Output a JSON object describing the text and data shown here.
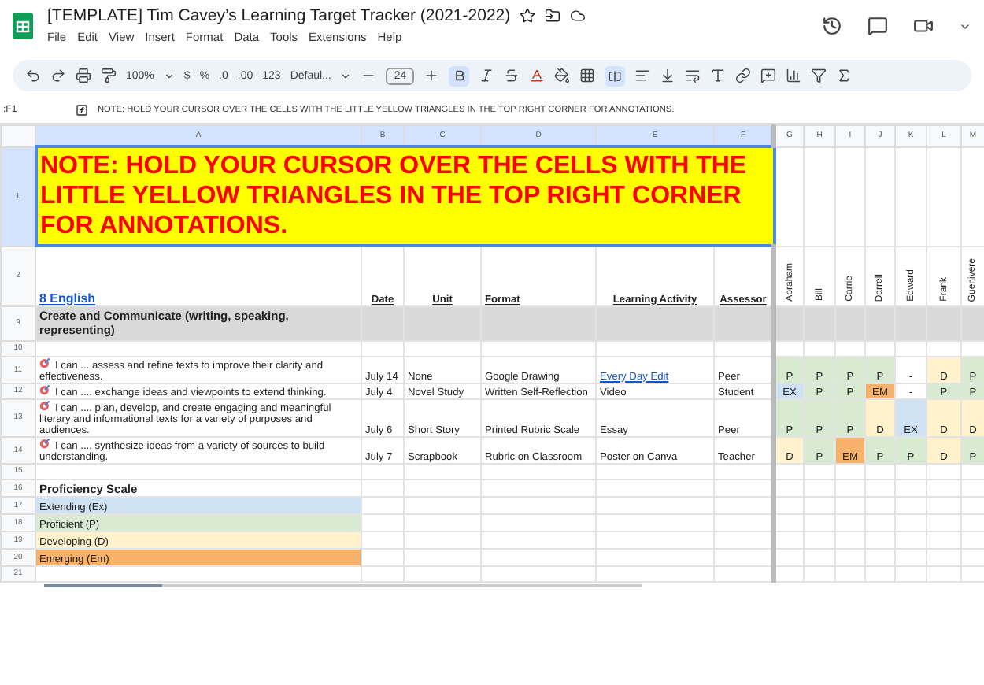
{
  "document": {
    "title": "[TEMPLATE] Tim Cavey’s Learning Target Tracker (2021-2022)"
  },
  "menu": [
    "File",
    "Edit",
    "View",
    "Insert",
    "Format",
    "Data",
    "Tools",
    "Extensions",
    "Help"
  ],
  "toolbar": {
    "zoom": "100%",
    "currency": "$",
    "percent": "%",
    "decrease_decimals": ".0",
    "increase_decimals": ".00",
    "number_format": "123",
    "font": "Defaul...",
    "font_size": "24",
    "bold_on": true,
    "merge_on": true
  },
  "formula_bar": {
    "cell_ref": ":F1",
    "formula": "NOTE: HOLD YOUR CURSOR OVER THE CELLS WITH THE LITTLE YELLOW TRIANGLES IN THE TOP RIGHT CORNER FOR ANNOTATIONS."
  },
  "columns": [
    {
      "label": "A",
      "selected": true
    },
    {
      "label": "B",
      "selected": true
    },
    {
      "label": "C",
      "selected": true
    },
    {
      "label": "D",
      "selected": true
    },
    {
      "label": "E",
      "selected": true
    },
    {
      "label": "F",
      "selected": true
    },
    {
      "label": "G",
      "selected": false
    },
    {
      "label": "H",
      "selected": false
    },
    {
      "label": "I",
      "selected": false
    },
    {
      "label": "J",
      "selected": false
    },
    {
      "label": "K",
      "selected": false
    },
    {
      "label": "L",
      "selected": false
    },
    {
      "label": "M",
      "selected": false
    }
  ],
  "rows": [
    {
      "kind": "note",
      "number": "1",
      "selected": true,
      "text": "NOTE: HOLD YOUR CURSOR OVER THE CELLS WITH THE LITTLE YELLOW TRIANGLES IN THE TOP RIGHT CORNER FOR ANNOTATIONS."
    },
    {
      "kind": "header",
      "number": "2",
      "selected": false,
      "title": "8 English",
      "headings": [
        "Date",
        "Unit",
        "Format",
        "Learning Activity",
        "Assessor"
      ],
      "students": [
        "Abraham",
        "Bill",
        "Carrie",
        "Darrell",
        "Edward",
        "Frank",
        "Guenivere"
      ]
    },
    {
      "kind": "section",
      "number": "9",
      "selected": false,
      "text": "Create and Communicate (writing, speaking, representing)"
    },
    {
      "kind": "blank",
      "number": "10",
      "selected": false
    },
    {
      "kind": "target",
      "number": "11",
      "selected": false,
      "text": "I can ... assess and refine texts to improve their clarity and effectiveness.",
      "date": "July 14",
      "unit": "None",
      "format": "Google Drawing",
      "activity": {
        "text": "Every Day Edit",
        "link": true
      },
      "assessor": "Peer",
      "grades": [
        {
          "grade": "P",
          "color": "#d9ead3"
        },
        {
          "grade": "P",
          "color": "#d9ead3"
        },
        {
          "grade": "P",
          "color": "#d9ead3"
        },
        {
          "grade": "P",
          "color": "#d9ead3"
        },
        {
          "grade": "-",
          "color": "#ffffff"
        },
        {
          "grade": "D",
          "color": "#fff2cc"
        },
        {
          "grade": "P",
          "color": "#d9ead3"
        }
      ]
    },
    {
      "kind": "target",
      "number": "12",
      "selected": false,
      "text": "I can .... exchange ideas and viewpoints to extend thinking.",
      "date": "July 4",
      "unit": "Novel Study",
      "format": "Written Self-Reflection",
      "activity": {
        "text": "Video",
        "link": false
      },
      "assessor": "Student",
      "grades": [
        {
          "grade": "EX",
          "color": "#cfe2f3"
        },
        {
          "grade": "P",
          "color": "#d9ead3"
        },
        {
          "grade": "P",
          "color": "#d9ead3"
        },
        {
          "grade": "EM",
          "color": "#f6b26b"
        },
        {
          "grade": "-",
          "color": "#ffffff"
        },
        {
          "grade": "P",
          "color": "#d9ead3"
        },
        {
          "grade": "P",
          "color": "#d9ead3"
        }
      ]
    },
    {
      "kind": "target",
      "number": "13",
      "selected": false,
      "text": "I can .... plan, develop, and create engaging and meaningful literary and informational texts for a variety of purposes and audiences.",
      "date": "July 6",
      "unit": "Short Story",
      "format": "Printed Rubric Scale",
      "activity": {
        "text": "Essay",
        "link": false
      },
      "assessor": "Peer",
      "grades": [
        {
          "grade": "P",
          "color": "#d9ead3"
        },
        {
          "grade": "P",
          "color": "#d9ead3"
        },
        {
          "grade": "P",
          "color": "#d9ead3"
        },
        {
          "grade": "D",
          "color": "#fff2cc"
        },
        {
          "grade": "EX",
          "color": "#cfe2f3"
        },
        {
          "grade": "D",
          "color": "#fff2cc"
        },
        {
          "grade": "D",
          "color": "#fff2cc"
        }
      ]
    },
    {
      "kind": "target",
      "number": "14",
      "selected": false,
      "text": "I can .... synthesize ideas from a variety of sources to build understanding.",
      "date": "July 7",
      "unit": "Scrapbook",
      "format": "Rubric on Classroom",
      "activity": {
        "text": "Poster on Canva",
        "link": false
      },
      "assessor": "Teacher",
      "grades": [
        {
          "grade": "D",
          "color": "#fff2cc"
        },
        {
          "grade": "P",
          "color": "#d9ead3"
        },
        {
          "grade": "EM",
          "color": "#f6b26b"
        },
        {
          "grade": "P",
          "color": "#d9ead3"
        },
        {
          "grade": "P",
          "color": "#d9ead3"
        },
        {
          "grade": "D",
          "color": "#fff2cc"
        },
        {
          "grade": "P",
          "color": "#d9ead3"
        }
      ]
    },
    {
      "kind": "blank",
      "number": "15",
      "selected": false
    },
    {
      "kind": "scale_title",
      "number": "16",
      "selected": false,
      "text": "Proficiency Scale"
    },
    {
      "kind": "scale",
      "number": "17",
      "selected": false,
      "text": "Extending (Ex)",
      "color": "#cfe2f3"
    },
    {
      "kind": "scale",
      "number": "18",
      "selected": false,
      "text": "Proficient (P)",
      "color": "#d9ead3"
    },
    {
      "kind": "scale",
      "number": "19",
      "selected": false,
      "text": "Developing (D)",
      "color": "#fff2cc"
    },
    {
      "kind": "scale",
      "number": "20",
      "selected": false,
      "text": "Emerging (Em)",
      "color": "#f6b26b"
    },
    {
      "kind": "blank",
      "number": "21",
      "selected": false
    }
  ]
}
